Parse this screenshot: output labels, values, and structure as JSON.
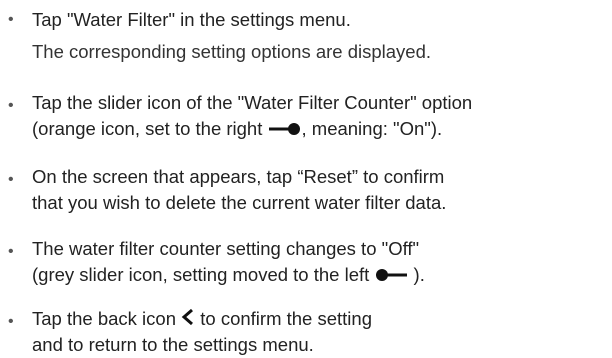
{
  "steps": [
    {
      "line1": "Tap \"Water Filter\" in the settings menu.",
      "line2": "The corresponding setting options are displayed."
    },
    {
      "line1": "Tap the slider icon of the \"Water Filter Counter\" option",
      "line2_before": "(orange icon, set to the right ",
      "line2_after": ", meaning: \"On\")."
    },
    {
      "line1": "On the screen that appears, tap “Reset” to confirm",
      "line2": "that you wish to delete the current water filter data."
    },
    {
      "line1": "The water filter counter setting changes to \"Off\"",
      "line2_before": "(grey slider icon, setting moved to the left ",
      "line2_after": " )."
    },
    {
      "line1_before": "Tap the back icon ",
      "line1_after": " to confirm the setting",
      "line2": "and to return to the settings menu."
    }
  ],
  "icons": {
    "slider_on": "slider-right-icon",
    "slider_off": "slider-left-icon",
    "back": "chevron-left-icon"
  },
  "bullet": "•"
}
